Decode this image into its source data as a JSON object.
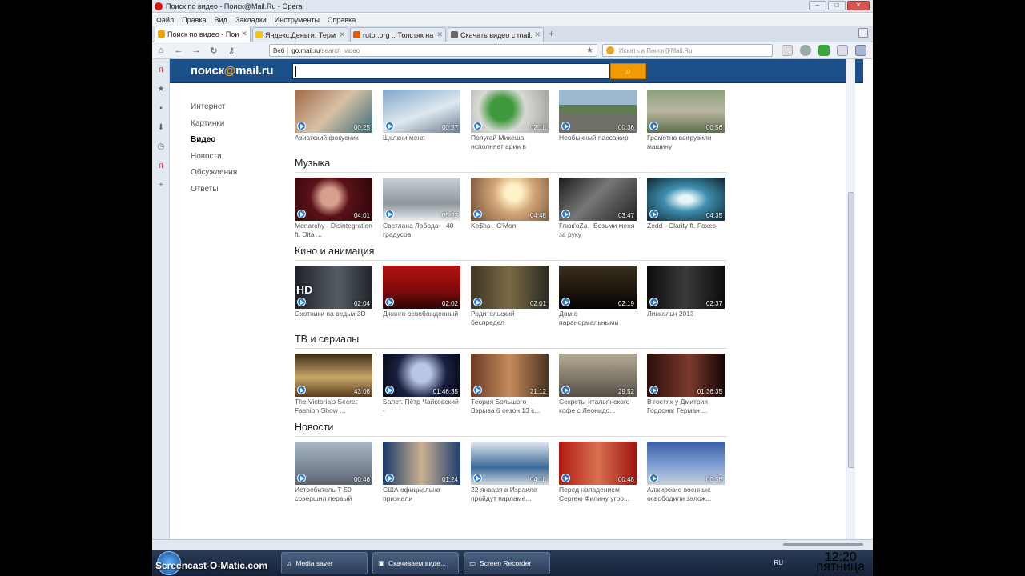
{
  "window": {
    "title": "Поиск по видео - Поиск@Mail.Ru - Opera"
  },
  "menu": [
    "Файл",
    "Правка",
    "Вид",
    "Закладки",
    "Инструменты",
    "Справка"
  ],
  "tabs": [
    {
      "label": "Поиск по видео - Пои...",
      "active": true,
      "color": "#f5a300"
    },
    {
      "label": "Яндекс.Деньги: Терми...",
      "active": false,
      "color": "#f7c600"
    },
    {
      "label": "rutor.org :: Толстяк на ...",
      "active": false,
      "color": "#e25a00"
    },
    {
      "label": "Скачать видео с mail.ru",
      "active": false,
      "color": "#666666"
    }
  ],
  "address": {
    "mode": "Веб",
    "host": "go.mail.ru",
    "path": "/search_video"
  },
  "search_box": {
    "placeholder": "Искать в Поиск@Mail.Ru"
  },
  "site": {
    "logo_prefix": "поиск",
    "logo_at": "@",
    "logo_suffix": "mail.ru",
    "search_button": "⌕"
  },
  "sidenav": [
    {
      "label": "Интернет",
      "active": false
    },
    {
      "label": "Картинки",
      "active": false
    },
    {
      "label": "Видео",
      "active": true
    },
    {
      "label": "Новости",
      "active": false
    },
    {
      "label": "Обсуждения",
      "active": false
    },
    {
      "label": "Ответы",
      "active": false
    }
  ],
  "sections": [
    {
      "title": "",
      "videos": [
        {
          "caption": "Азиатский фокусник",
          "duration": "00:25",
          "bg": "linear-gradient(135deg,#a06a48,#d8c0a6 50%,#3a6f7a)"
        },
        {
          "caption": "Щелкни меня",
          "duration": "00:37",
          "bg": "linear-gradient(160deg,#7fa8c9,#e0e8ee 55%,#6a7e92)"
        },
        {
          "caption": "Попугай Микеша исполняет арии в",
          "duration": "02:18",
          "bg": "radial-gradient(circle at 40% 45%,#3f9a3c 0 22%,#d8d9d4 45%,#9da19c)"
        },
        {
          "caption": "Необычный пассажир",
          "duration": "00:36",
          "bg": "linear-gradient(#9bb8cf 0 35%,#5e7d4e 35% 55%,#6f6f68 55%)"
        },
        {
          "caption": "Грамотно выгрузили машину",
          "duration": "00:56",
          "bg": "linear-gradient(#8aa07a,#b9b6a0 50%,#5d6e4a)"
        }
      ]
    },
    {
      "title": "Музыка",
      "videos": [
        {
          "caption": "Monarchy - Disintegration ft. Dita ...",
          "duration": "04:01",
          "bg": "radial-gradient(circle at 45% 45%,#d7a08e 0 18%,#5a1218 40%,#2b0509)"
        },
        {
          "caption": "Светлана Лобода – 40 градусов",
          "duration": "05:23",
          "bg": "linear-gradient(#c9cfd4,#8e979d 60%,#e8ecef)"
        },
        {
          "caption": "Ke$ha - C'Mon",
          "duration": "04:48",
          "bg": "radial-gradient(circle at 55% 35%,#fff2c8 0 15%,#d2a678 40%,#6b4a32)"
        },
        {
          "caption": "Глюк'oZa - Возьми меня за руку",
          "duration": "03:47",
          "bg": "linear-gradient(135deg,#1a1a1a,#777 45%,#222)"
        },
        {
          "caption": "Zedd - Clarity ft. Foxes",
          "duration": "04:35",
          "bg": "radial-gradient(ellipse at 50% 50%,#e8f6fb 0 12%,#3f8fb0 40%,#0d2530)"
        }
      ]
    },
    {
      "title": "Кино и анимация",
      "videos": [
        {
          "caption": "Охотники на ведьм 3D",
          "duration": "02:04",
          "bg": "linear-gradient(90deg,#1e2228,#555c64 55%,#20242a)",
          "hd": "HD"
        },
        {
          "caption": "Джанго освобожденный",
          "duration": "02:02",
          "bg": "linear-gradient(#b31212,#7d0b0b 60%,#2a0606)"
        },
        {
          "caption": "Родительский беспредел",
          "duration": "02:01",
          "bg": "linear-gradient(90deg,#3e3624,#7a6a44 50%,#2b2a22)"
        },
        {
          "caption": "Дом с паранормальными",
          "duration": "02:19",
          "bg": "linear-gradient(#3a3020,#1a140c 60%,#050403)"
        },
        {
          "caption": "Линкольн 2013",
          "duration": "02:37",
          "bg": "linear-gradient(90deg,#0c0c0c,#3a3a3a 50%,#0c0c0c)"
        }
      ]
    },
    {
      "title": "ТВ и сериалы",
      "videos": [
        {
          "caption": "The Victoria's Secret Fashion Show ...",
          "duration": "43:06",
          "bg": "linear-gradient(#3a2a14,#c8a66b 55%,#5a3d1c)"
        },
        {
          "caption": "Балет. Пётр Чайковский -",
          "duration": "01:46:35",
          "bg": "radial-gradient(circle at 50% 45%,#b8c6e8 0 20%,#1a2040 55%,#05070f)"
        },
        {
          "caption": "Теория Большого Взрыва 6 сезон 13 с...",
          "duration": "21:12",
          "bg": "linear-gradient(90deg,#6b3a24,#c58b5c 50%,#4a3320)"
        },
        {
          "caption": "Секреты итальянского кофе с Леонидо...",
          "duration": "29:52",
          "bg": "linear-gradient(#b4aa96,#7d7566 60%,#56504a)"
        },
        {
          "caption": "В гостях у Дмитрия Гордона: Герман ...",
          "duration": "01:36:35",
          "bg": "linear-gradient(90deg,#2c0d0a,#7b3a2c 55%,#140504)"
        }
      ]
    },
    {
      "title": "Новости",
      "videos": [
        {
          "caption": "Истребитель Т-50 совершил первый",
          "duration": "00:46",
          "bg": "linear-gradient(#a9b6c4,#7b8894 60%,#5b6470)"
        },
        {
          "caption": "США официально признали",
          "duration": "01:24",
          "bg": "linear-gradient(90deg,#1a3a6a,#c9b090 50%,#203e72)"
        },
        {
          "caption": "22 января в Израиле пройдут парламе...",
          "duration": "04:18",
          "bg": "linear-gradient(#dfe6ee,#3c6a9a 60%,#cfd7e0)"
        },
        {
          "caption": "Перед нападением Сергею Филину угро...",
          "duration": "00:48",
          "bg": "linear-gradient(90deg,#b21a10,#d87050 50%,#a01510)"
        },
        {
          "caption": "Алжирские военные освободили залож...",
          "duration": "00:56",
          "bg": "linear-gradient(#3a5fa8,#7e9ed0 55%,#c7cfda)"
        }
      ]
    }
  ],
  "taskbar": {
    "watermark": "Screencast-O-Matic.com",
    "buttons": [
      {
        "label": "Media saver"
      },
      {
        "label": "Скачиваем виде..."
      },
      {
        "label": "Screen Recorder"
      }
    ],
    "lang": "RU",
    "time": "12:20",
    "day": "пятница"
  }
}
